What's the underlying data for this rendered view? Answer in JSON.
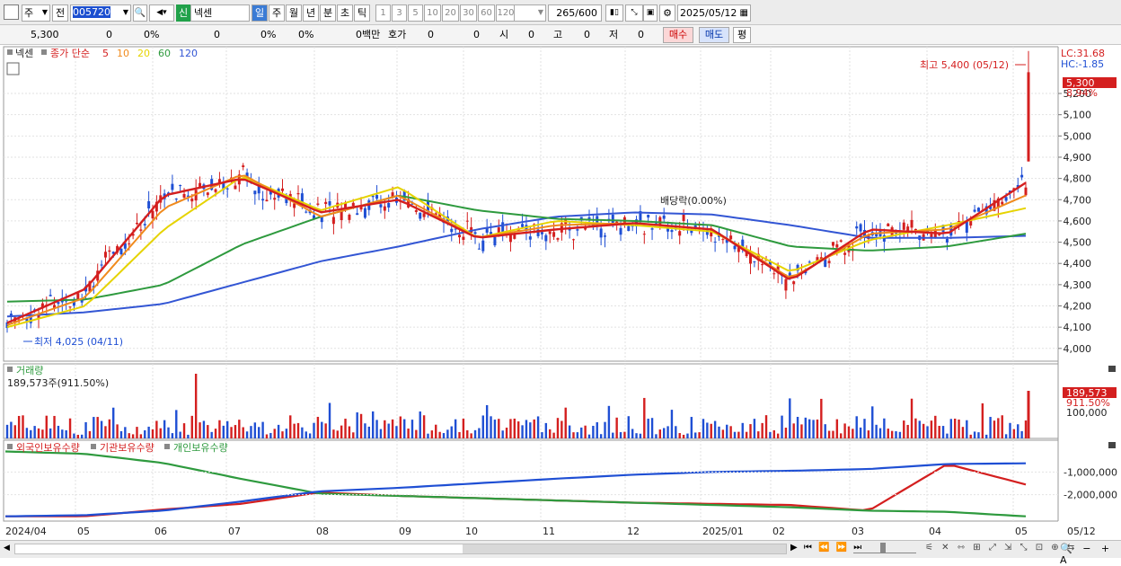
{
  "toolbar": {
    "period": "주",
    "prev_label": "전",
    "code": "005720",
    "badge": "신",
    "stock_name": "넥센",
    "timeframes": [
      "일",
      "주",
      "월",
      "년",
      "분",
      "초",
      "틱"
    ],
    "active_timeframe": "일",
    "numbers": [
      "1",
      "3",
      "5",
      "10",
      "20",
      "30",
      "60",
      "120"
    ],
    "count": "265",
    "count_total": "/600",
    "date": "2025/05/12"
  },
  "quote_bar": {
    "price": "5,300",
    "v1": "0",
    "v2": "0%",
    "v3": "0",
    "v4": "0%",
    "v5": "0%",
    "v6": "0백만",
    "hoga_label": "호가",
    "v7": "0",
    "v8": "0",
    "si_label": "시",
    "si_val": "0",
    "go_label": "고",
    "go_val": "0",
    "jeo_label": "저",
    "jeo_val": "0",
    "buy_label": "매수",
    "sell_label": "매도",
    "pyeong_label": "평"
  },
  "price_panel": {
    "name": "넥센",
    "legend_main": "종가 단순",
    "legend_ma": [
      {
        "label": "5",
        "color": "#d41f1f"
      },
      {
        "label": "10",
        "color": "#f08a1c"
      },
      {
        "label": "20",
        "color": "#e6d300"
      },
      {
        "label": "60",
        "color": "#2e9a3e"
      },
      {
        "label": "120",
        "color": "#3356d4"
      }
    ],
    "lc": "LC:31.68",
    "hc": "HC:-1.85",
    "high_annot": "최고 5,400 (05/12)",
    "low_annot": "최저 4,025 (04/11)",
    "div_annot": "배당락(0.00%)",
    "last_price": "5,300",
    "last_pct": "8.94%",
    "y_ticks": [
      "5,200",
      "5,100",
      "5,000",
      "4,900",
      "4,800",
      "4,700",
      "4,600",
      "4,500",
      "4,400",
      "4,300",
      "4,200",
      "4,100",
      "4,000"
    ]
  },
  "volume_panel": {
    "title": "거래량",
    "value": "189,573주(911.50%)",
    "last": "189,573",
    "last_pct": "911.50%",
    "tick": "100,000"
  },
  "holdings_panel": {
    "legend": [
      {
        "label": "외국인보유수량",
        "color": "#d41f1f"
      },
      {
        "label": "기관보유수량",
        "color": "#d41f1f"
      },
      {
        "label": "개인보유수량",
        "color": "#2e9a3e"
      }
    ],
    "ticks": [
      "-1,000,000",
      "-2,000,000"
    ]
  },
  "x_axis": {
    "labels": [
      "2024/04",
      "05",
      "06",
      "07",
      "08",
      "09",
      "10",
      "11",
      "12",
      "2025/01",
      "02",
      "03",
      "04",
      "05"
    ],
    "right_label": "05/12"
  },
  "chart_data": [
    {
      "type": "line",
      "title": "넥센",
      "x": [
        "2024/04",
        "2024/05",
        "2024/06",
        "2024/07",
        "2024/08",
        "2024/09",
        "2024/10",
        "2024/11",
        "2024/12",
        "2025/01",
        "2025/02",
        "2025/03",
        "2025/04",
        "2025/05"
      ],
      "ylim": [
        4000,
        5400
      ],
      "series": [
        {
          "name": "5",
          "values": [
            4120,
            4280,
            4720,
            4800,
            4640,
            4700,
            4520,
            4560,
            4590,
            4560,
            4320,
            4560,
            4540,
            4780
          ]
        },
        {
          "name": "10",
          "values": [
            4110,
            4240,
            4660,
            4820,
            4620,
            4720,
            4520,
            4580,
            4590,
            4560,
            4330,
            4540,
            4560,
            4720
          ]
        },
        {
          "name": "20",
          "values": [
            4100,
            4200,
            4560,
            4810,
            4650,
            4760,
            4520,
            4600,
            4580,
            4550,
            4360,
            4510,
            4580,
            4660
          ]
        },
        {
          "name": "60",
          "values": [
            4220,
            4230,
            4300,
            4490,
            4620,
            4720,
            4650,
            4610,
            4600,
            4580,
            4480,
            4460,
            4480,
            4540
          ]
        },
        {
          "name": "120",
          "values": [
            4150,
            4170,
            4210,
            4310,
            4410,
            4480,
            4560,
            4620,
            4640,
            4630,
            4580,
            4520,
            4520,
            4530
          ]
        }
      ],
      "high": 5400,
      "low": 4025,
      "last": 5300
    },
    {
      "type": "bar",
      "title": "거래량",
      "last_value": 189573
    },
    {
      "type": "line",
      "title": "보유수량",
      "ylim": [
        -3000000,
        0
      ],
      "series": [
        {
          "name": "외국인보유수량",
          "values": [
            -2950000,
            -2950000,
            -2650000,
            -2400000,
            -1900000,
            -2050000,
            -2150000,
            -2250000,
            -2350000,
            -2400000,
            -2450000,
            -2700000,
            -650000,
            -1550000
          ]
        },
        {
          "name": "개인보유수량",
          "values": [
            -100000,
            -200000,
            -600000,
            -1300000,
            -1950000,
            -2050000,
            -2150000,
            -2250000,
            -2350000,
            -2450000,
            -2550000,
            -2700000,
            -2750000,
            -2950000
          ]
        },
        {
          "name": "기관보유수량",
          "values": [
            -2950000,
            -2900000,
            -2700000,
            -2300000,
            -1850000,
            -1700000,
            -1500000,
            -1300000,
            -1120000,
            -1000000,
            -950000,
            -870000,
            -650000,
            -620000
          ]
        }
      ]
    }
  ]
}
